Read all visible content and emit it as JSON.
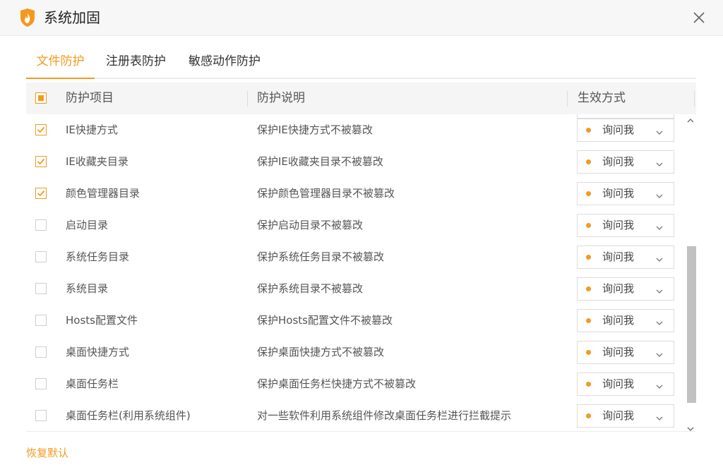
{
  "window": {
    "title": "系统加固",
    "app_icon": "flame-shield-icon",
    "close_icon": "close-icon"
  },
  "tabs": [
    {
      "label": "文件防护",
      "active": true
    },
    {
      "label": "注册表防护",
      "active": false
    },
    {
      "label": "敏感动作防护",
      "active": false
    }
  ],
  "table": {
    "select_all_state": "indeterminate",
    "columns": {
      "item": "防护项目",
      "description": "防护说明",
      "mode": "生效方式"
    },
    "rows": [
      {
        "name": "IE快捷方式",
        "description": "保护IE快捷方式不被篡改",
        "mode": "询问我",
        "checked": true
      },
      {
        "name": "IE收藏夹目录",
        "description": "保护IE收藏夹目录不被篡改",
        "mode": "询问我",
        "checked": true
      },
      {
        "name": "颜色管理器目录",
        "description": "保护颜色管理器目录不被篡改",
        "mode": "询问我",
        "checked": true
      },
      {
        "name": "启动目录",
        "description": "保护启动目录不被篡改",
        "mode": "询问我",
        "checked": false
      },
      {
        "name": "系统任务目录",
        "description": "保护系统任务目录不被篡改",
        "mode": "询问我",
        "checked": false
      },
      {
        "name": "系统目录",
        "description": "保护系统目录不被篡改",
        "mode": "询问我",
        "checked": false
      },
      {
        "name": "Hosts配置文件",
        "description": "保护Hosts配置文件不被篡改",
        "mode": "询问我",
        "checked": false
      },
      {
        "name": "桌面快捷方式",
        "description": "保护桌面快捷方式不被篡改",
        "mode": "询问我",
        "checked": false
      },
      {
        "name": "桌面任务栏",
        "description": "保护桌面任务栏快捷方式不被篡改",
        "mode": "询问我",
        "checked": false
      },
      {
        "name": "桌面任务栏(利用系统组件)",
        "description": "对一些软件利用系统组件修改桌面任务栏进行拦截提示",
        "mode": "询问我",
        "checked": false
      }
    ]
  },
  "footer": {
    "restore_default": "恢复默认"
  },
  "colors": {
    "accent": "#f39a1e",
    "header_bg": "#f5f5f5",
    "titlebar_bg": "#f7f7f7"
  }
}
